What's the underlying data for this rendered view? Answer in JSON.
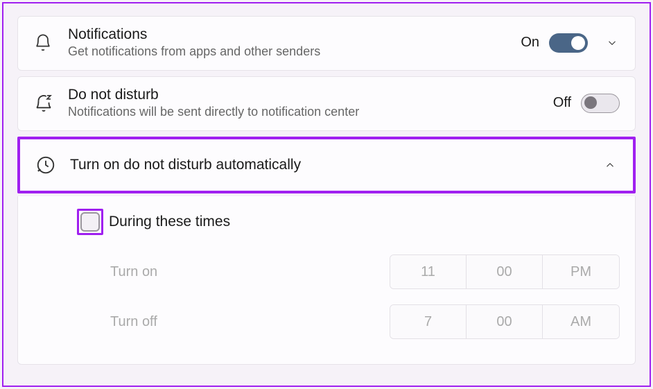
{
  "notifications": {
    "title": "Notifications",
    "subtitle": "Get notifications from apps and other senders",
    "state": "On"
  },
  "dnd": {
    "title": "Do not disturb",
    "subtitle": "Notifications will be sent directly to notification center",
    "state": "Off"
  },
  "autoDnd": {
    "title": "Turn on do not disturb automatically"
  },
  "duringTimes": {
    "label": "During these times",
    "turnOn": {
      "label": "Turn on",
      "hour": "11",
      "minute": "00",
      "ampm": "PM"
    },
    "turnOff": {
      "label": "Turn off",
      "hour": "7",
      "minute": "00",
      "ampm": "AM"
    }
  }
}
